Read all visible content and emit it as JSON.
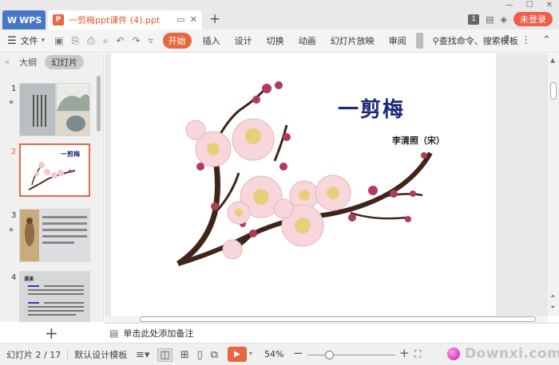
{
  "titlebar": {
    "wps_label": "WPS",
    "doc_tab_icon": "P",
    "doc_title": "一剪梅ppt课件 (4).ppt",
    "status_num": "1",
    "login_label": "未登录"
  },
  "ribbon": {
    "menu_label": "文件",
    "tabs": [
      "开始",
      "插入",
      "设计",
      "切换",
      "动画",
      "幻灯片放映",
      "审阅"
    ],
    "active_tab": 0,
    "search_label": "查找命令、搜索模板"
  },
  "left_panel": {
    "tab_outline": "大纲",
    "tab_slides": "幻灯片",
    "slides": [
      {
        "num": "1",
        "starred": true
      },
      {
        "num": "2",
        "starred": false,
        "active": true,
        "mini_title": "一剪梅"
      },
      {
        "num": "3",
        "starred": true
      },
      {
        "num": "4",
        "starred": false,
        "mini_title": "诵读"
      }
    ]
  },
  "slide": {
    "title": "一剪梅",
    "author": "李清照（宋）"
  },
  "notes": {
    "placeholder": "单击此处添加备注"
  },
  "statusbar": {
    "slide_counter": "幻灯片 2 / 17",
    "template_label": "默认设计模板",
    "zoom_value": "54%",
    "zoom_level": 0.54
  },
  "watermark": {
    "text": "Downxi.com"
  },
  "colors": {
    "accent": "#e7683f",
    "wps_blue": "#4a76c6",
    "title_navy": "#1e2a7a",
    "login_red": "#ed5e4b"
  }
}
